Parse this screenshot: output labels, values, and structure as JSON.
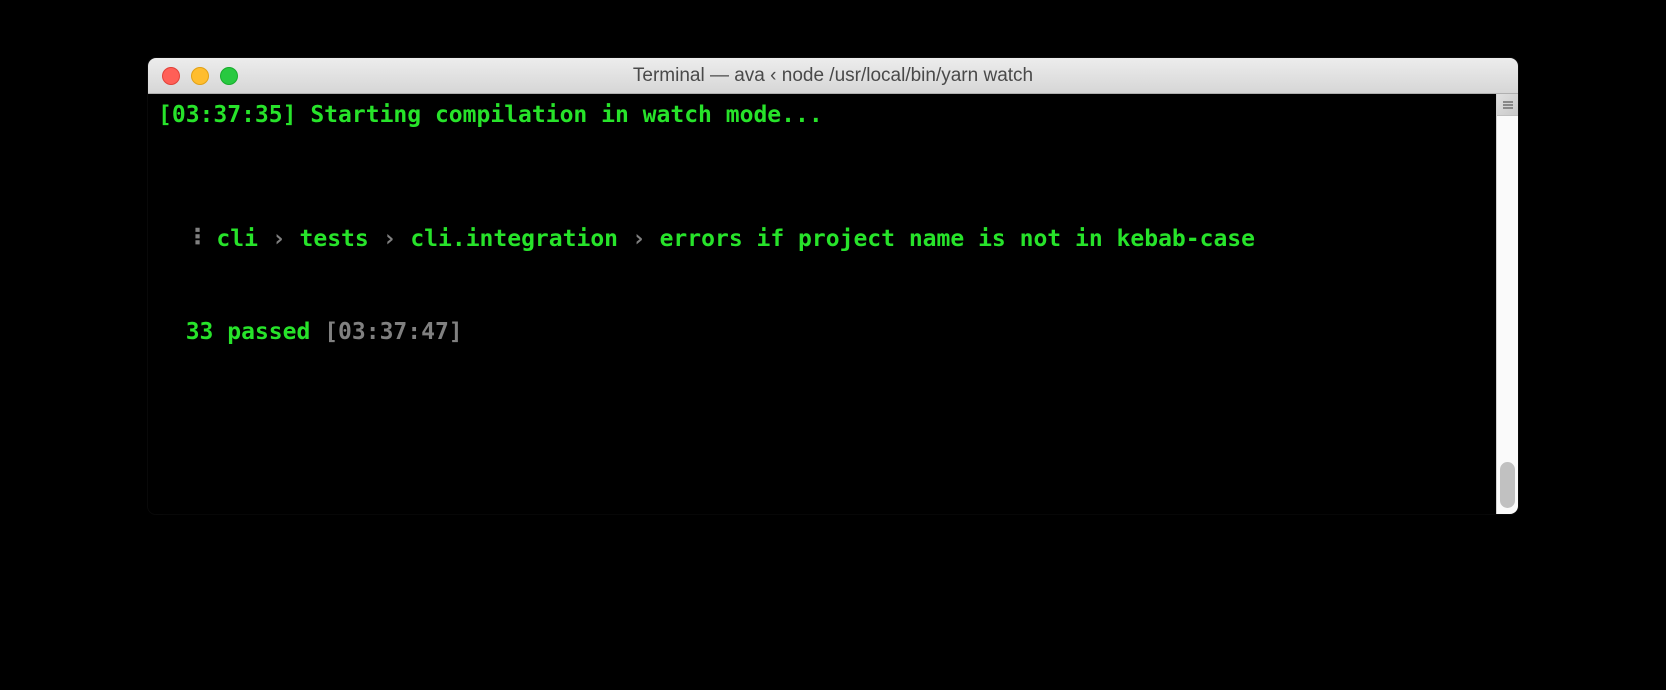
{
  "window": {
    "title": "Terminal — ava ‹ node /usr/local/bin/yarn watch"
  },
  "lines": {
    "l1_time": "[03:37:35]",
    "l1_rest": " Starting compilation in watch mode...",
    "spinner": "⠸",
    "breadcrumb": {
      "p1": "cli",
      "p2": "tests",
      "p3": "cli.integration",
      "p4": "errors if project name is not in kebab-case",
      "sep": " › "
    },
    "result_count": "33 passed",
    "result_time": "[03:37:47]"
  }
}
